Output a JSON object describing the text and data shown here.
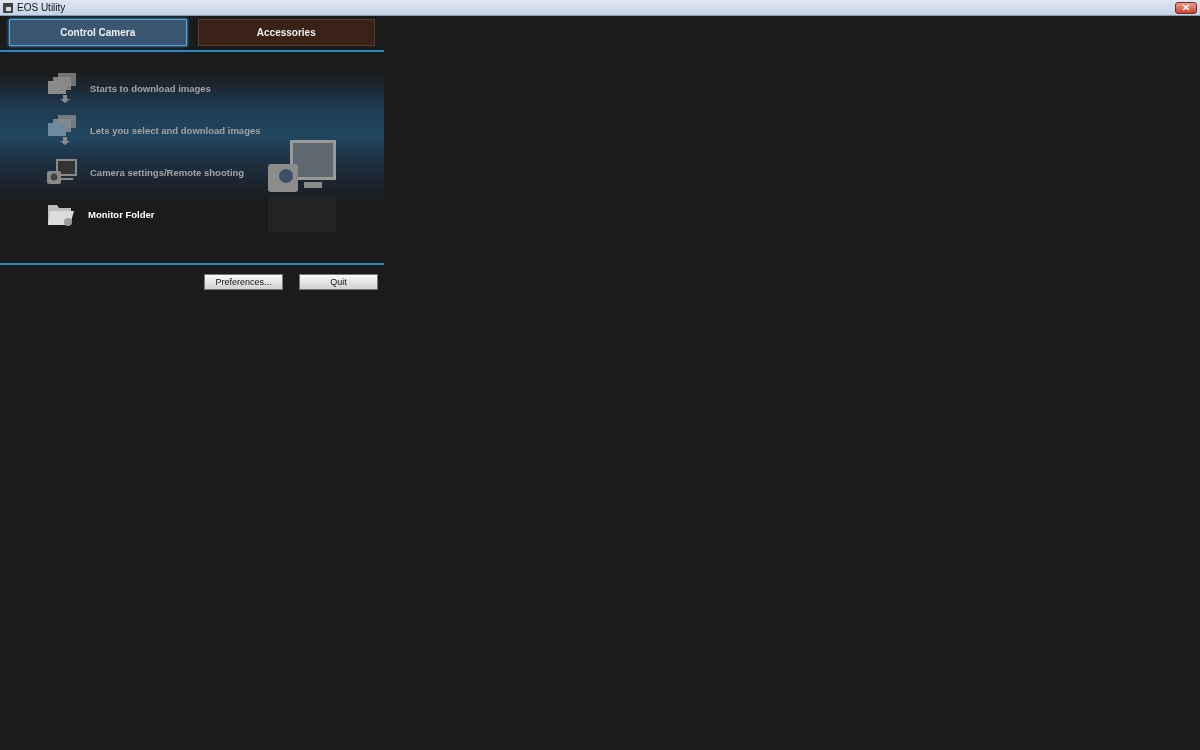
{
  "window": {
    "title": "EOS Utility"
  },
  "tabs": [
    {
      "label": "Control Camera",
      "selected": true
    },
    {
      "label": "Accessories",
      "selected": false
    }
  ],
  "menu_items": [
    {
      "kind": "download",
      "label": "Starts to download images",
      "disabled": true
    },
    {
      "kind": "select",
      "label": "Lets you select and download images",
      "disabled": true
    },
    {
      "kind": "camera",
      "label": "Camera settings/Remote shooting",
      "disabled": true
    },
    {
      "kind": "folder",
      "label": "Monitor Folder",
      "disabled": false
    }
  ],
  "buttons": [
    "Preferences...",
    "Quit"
  ]
}
